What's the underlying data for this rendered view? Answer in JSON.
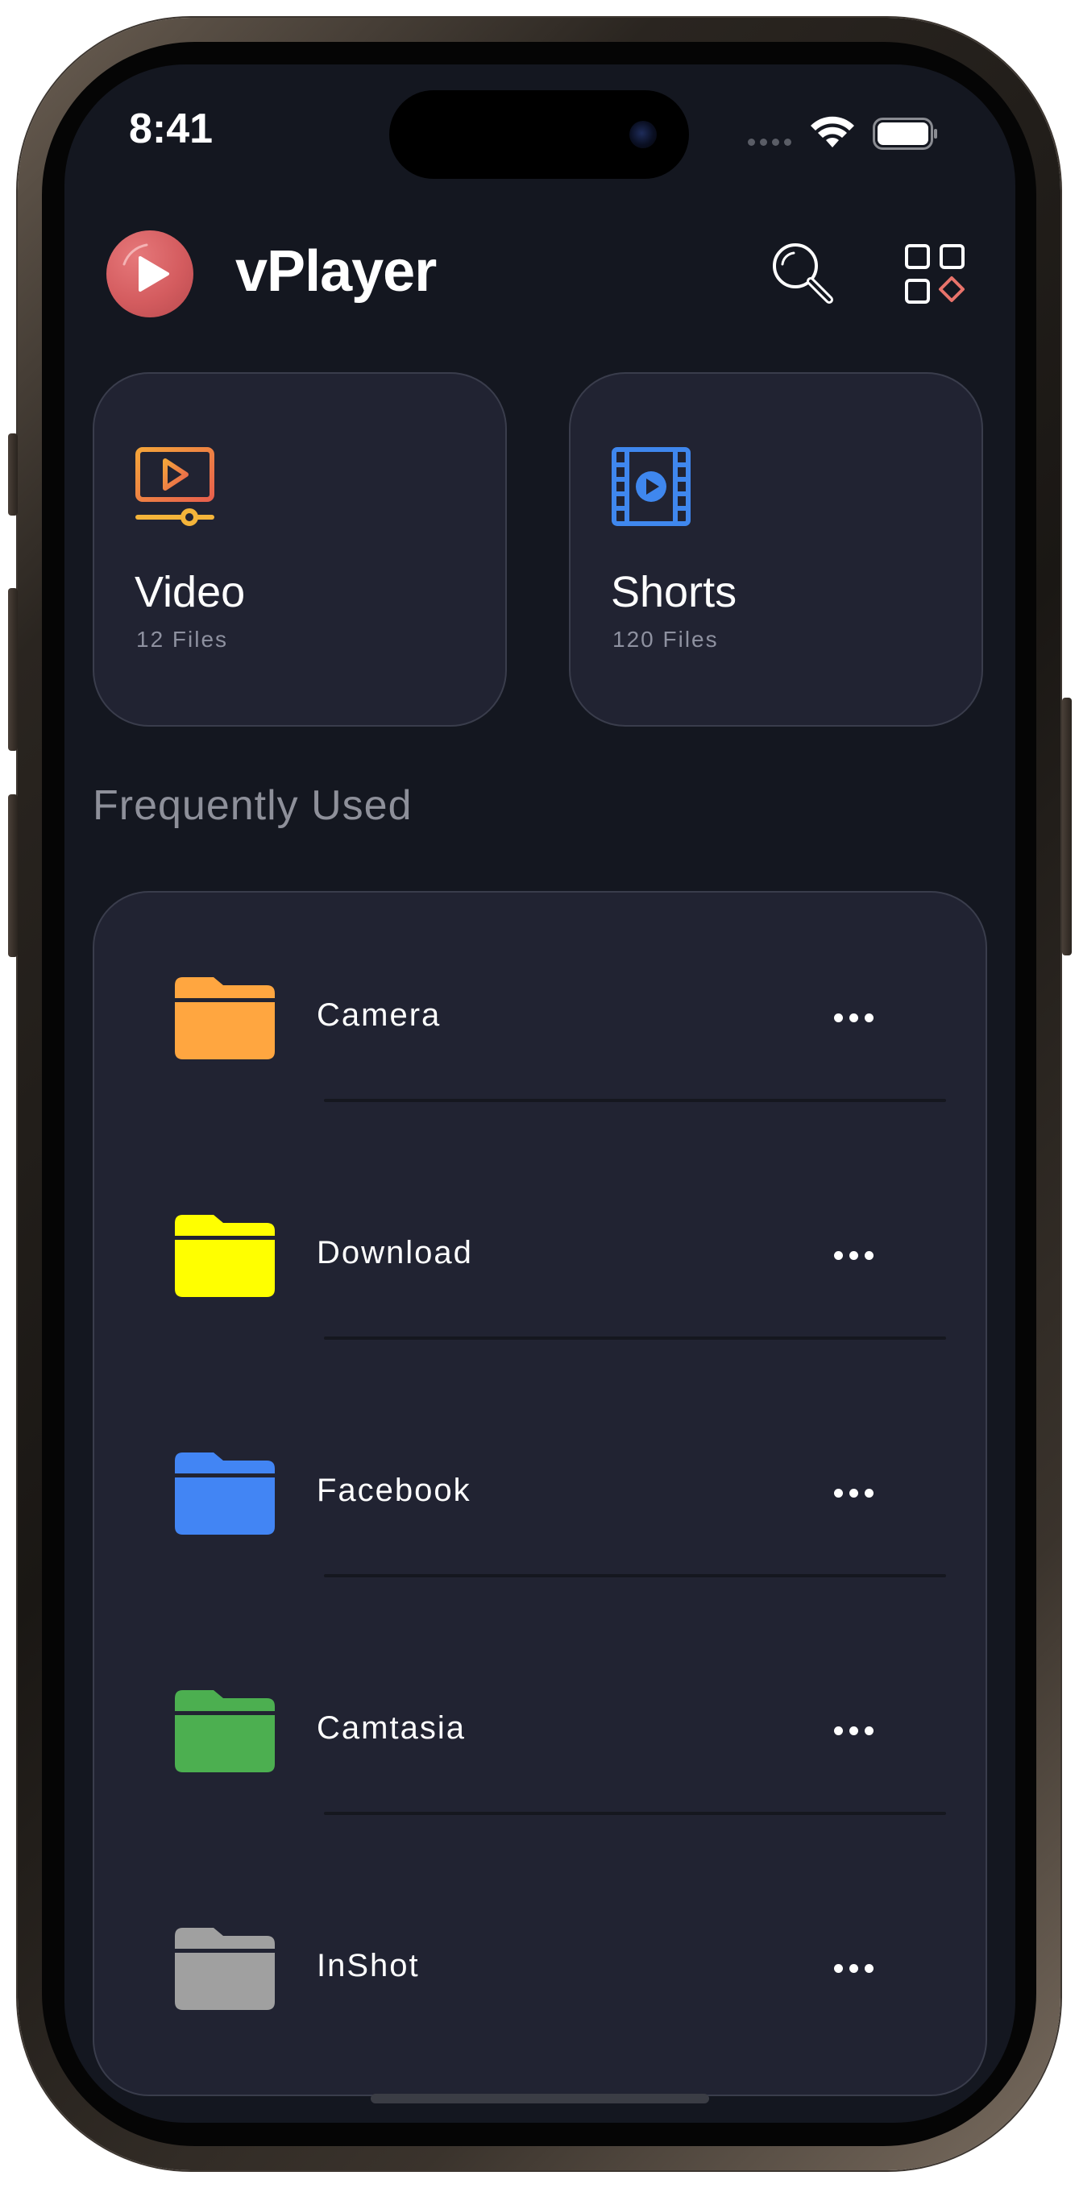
{
  "status_bar": {
    "time": "8:41",
    "icons": [
      "signal-icon",
      "wifi-icon",
      "battery-icon"
    ]
  },
  "header": {
    "app_name": "vPlayer",
    "logo_icon": "play-icon",
    "actions": [
      "search-icon",
      "categories-icon"
    ]
  },
  "categories": [
    {
      "title": "Video",
      "count": "12 Files",
      "icon": "video-player-icon",
      "color": "#f2a53b"
    },
    {
      "title": "Shorts",
      "count": "120 Files",
      "icon": "film-reel-icon",
      "color": "#3f87ee"
    }
  ],
  "frequently_used": {
    "title": "Frequently Used",
    "folders": [
      {
        "name": "Camera",
        "color": "#ffa640",
        "icon": "folder-icon"
      },
      {
        "name": "Download",
        "color": "#ffff00",
        "icon": "folder-icon"
      },
      {
        "name": "Facebook",
        "color": "#4285f4",
        "icon": "folder-icon"
      },
      {
        "name": "Camtasia",
        "color": "#4caf50",
        "icon": "folder-icon"
      },
      {
        "name": "InShot",
        "color": "#a0a0a0",
        "icon": "folder-icon"
      }
    ]
  },
  "colors": {
    "background": "#141720",
    "card": "#212332",
    "accent_red": "#d45c5f"
  }
}
